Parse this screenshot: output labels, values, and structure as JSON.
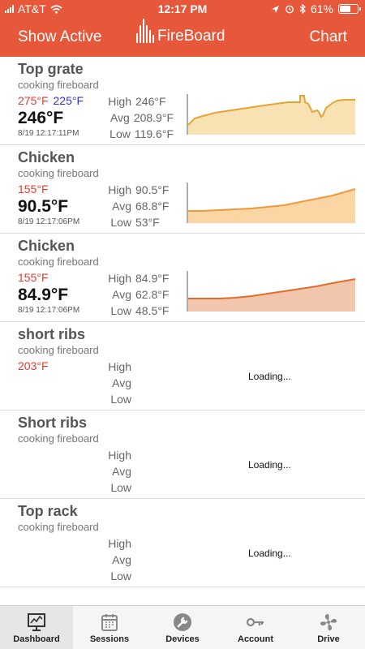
{
  "status": {
    "carrier": "AT&T",
    "time": "12:17 PM",
    "battery": "61%",
    "battery_level": 0.61
  },
  "header": {
    "left": "Show Active",
    "logo": "FireBoard",
    "right": "Chart"
  },
  "colors": {
    "accent": "#e7573a",
    "target_high": "#e23c2c",
    "target_low": "#3232d0"
  },
  "channels": [
    {
      "title": "Top grate",
      "subtitle": "cooking fireboard",
      "target_high": "275°F",
      "target_low": "225°F",
      "current": "246°F",
      "timestamp": "8/19 12:17:11PM",
      "high_label": "High",
      "high": "246°F",
      "avg_label": "Avg",
      "avg": "208.9°F",
      "low_label": "Low",
      "low": "119.6°F",
      "spark_color": "#e5a534",
      "spark_fill": "#f8e2b4"
    },
    {
      "title": "Chicken",
      "subtitle": "cooking fireboard",
      "target_high": "155°F",
      "current": "90.5°F",
      "timestamp": "8/19 12:17:06PM",
      "high_label": "High",
      "high": "90.5°F",
      "avg_label": "Avg",
      "avg": "68.8°F",
      "low_label": "Low",
      "low": "53°F",
      "spark_color": "#ee9a3c",
      "spark_fill": "#fbd5a3"
    },
    {
      "title": "Chicken",
      "subtitle": "cooking fireboard",
      "target_high": "155°F",
      "current": "84.9°F",
      "timestamp": "8/19 12:17:06PM",
      "high_label": "High",
      "high": "84.9°F",
      "avg_label": "Avg",
      "avg": "62.8°F",
      "low_label": "Low",
      "low": "48.5°F",
      "spark_color": "#e06d2c",
      "spark_fill": "#f2c6ad"
    },
    {
      "title": "short ribs",
      "subtitle": "cooking fireboard",
      "target_high": "203°F",
      "high_label": "High",
      "avg_label": "Avg",
      "low_label": "Low",
      "loading": "Loading..."
    },
    {
      "title": "Short ribs",
      "subtitle": "cooking fireboard",
      "high_label": "High",
      "avg_label": "Avg",
      "low_label": "Low",
      "loading": "Loading..."
    },
    {
      "title": "Top rack",
      "subtitle": "cooking fireboard",
      "high_label": "High",
      "avg_label": "Avg",
      "low_label": "Low",
      "loading": "Loading..."
    }
  ],
  "tabs": [
    {
      "label": "Dashboard",
      "icon": "dashboard-icon",
      "active": true
    },
    {
      "label": "Sessions",
      "icon": "calendar-icon"
    },
    {
      "label": "Devices",
      "icon": "wrench-icon"
    },
    {
      "label": "Account",
      "icon": "key-icon"
    },
    {
      "label": "Drive",
      "icon": "fan-icon"
    }
  ]
}
